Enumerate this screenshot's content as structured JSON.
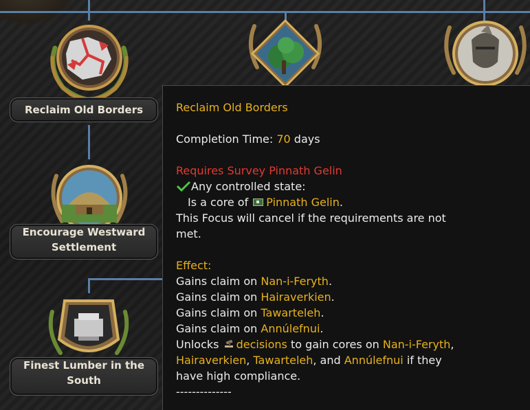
{
  "focus_tree": {
    "nodes": [
      {
        "id": "reclaim",
        "label": "Reclaim Old Borders",
        "icon": "map-borders-icon"
      },
      {
        "id": "forest",
        "label": "",
        "icon": "forest-icon"
      },
      {
        "id": "warrior",
        "label": "",
        "icon": "helmeted-warrior-icon"
      },
      {
        "id": "westward",
        "label_lines": [
          "Encourage Westward",
          "Settlement"
        ],
        "icon": "hut-icon"
      },
      {
        "id": "lumber",
        "label_lines": [
          "Finest Lumber in the",
          "South"
        ],
        "icon": "anvil-icon"
      }
    ]
  },
  "tooltip": {
    "title": "Reclaim Old Borders",
    "completion_prefix": "Completion Time: ",
    "completion_value": "70",
    "completion_suffix": " days",
    "requires": "Requires Survey Pinnath Gelin",
    "check_line": "Any controlled state:",
    "core_prefix": "Is a core of ",
    "core_country": "Pinnath Gelin",
    "core_suffix": ".",
    "cancel_line1": "This Focus will cancel if the requirements are not",
    "cancel_line2": "met.",
    "effect_label": "Effect:",
    "claims": [
      {
        "prefix": "Gains claim on ",
        "name": "Nan-i-Feryth",
        "suffix": "."
      },
      {
        "prefix": "Gains claim on ",
        "name": "Hairaverkien",
        "suffix": "."
      },
      {
        "prefix": "Gains claim on ",
        "name": "Tawarteleh",
        "suffix": "."
      },
      {
        "prefix": "Gains claim on ",
        "name": "Annúlefnui",
        "suffix": "."
      }
    ],
    "unlocks_prefix": "Unlocks ",
    "decisions_word": "decisions",
    "unlocks_mid": " to gain cores on ",
    "unlock_1": "Nan-i-Feryth",
    "unlock_1_sep": ",",
    "unlock_2": "Hairaverkien",
    "unlock_2_sep": ", ",
    "unlock_3": "Tawarteleh",
    "unlock_3_sep": ", and ",
    "unlock_4": "Annúlefnui",
    "unlock_tail": " if they",
    "unlock_last_line": "have high compliance.",
    "separator": "--------------"
  },
  "colors": {
    "gold_text": "#e8b21c",
    "red_text": "#e23a32",
    "green_check": "#51c447",
    "connector": "#5a7fa8"
  }
}
